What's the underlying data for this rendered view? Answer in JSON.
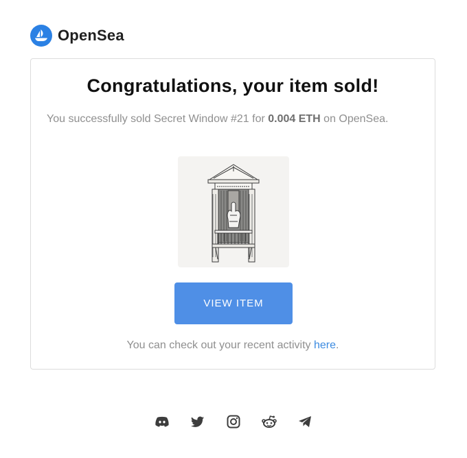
{
  "brand": {
    "name": "OpenSea",
    "logo_icon": "opensea-boat-logo",
    "accent": "#2b81e4"
  },
  "card": {
    "title": "Congratulations, your item sold!",
    "message_prefix": "You successfully sold Secret Window #21 for ",
    "price": "0.004 ETH",
    "message_suffix": " on OpenSea.",
    "artwork_alt": "Secret Window #21",
    "button_label": "VIEW ITEM",
    "button_color": "#4f8fe6",
    "activity_prefix": "You can check out your recent activity ",
    "activity_link": "here",
    "activity_suffix": "."
  },
  "footer": {
    "social_icons": [
      "discord-icon",
      "twitter-icon",
      "instagram-icon",
      "reddit-icon",
      "telegram-icon"
    ]
  }
}
